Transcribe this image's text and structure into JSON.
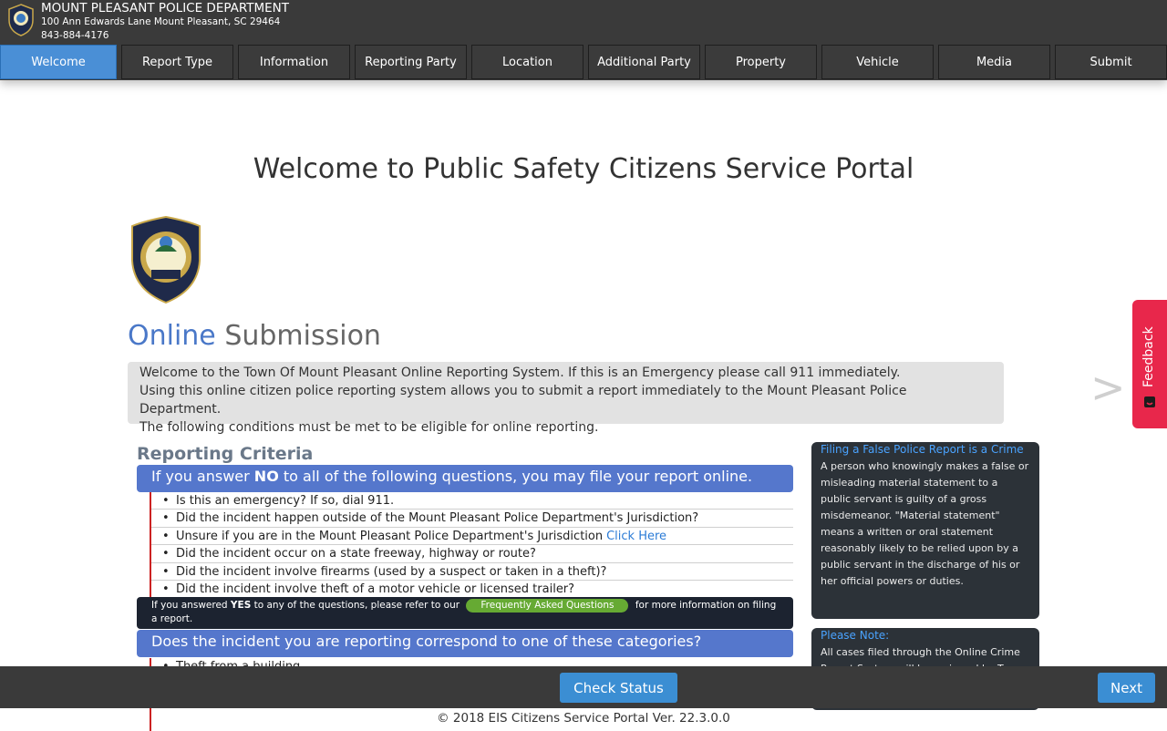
{
  "header": {
    "dept_name": "MOUNT PLEASANT POLICE DEPARTMENT",
    "address": "100 Ann Edwards Lane Mount Pleasant, SC 29464",
    "phone": "843-884-4176"
  },
  "tabs": [
    {
      "label": "Welcome",
      "active": true
    },
    {
      "label": "Report Type"
    },
    {
      "label": "Information"
    },
    {
      "label": "Reporting Party"
    },
    {
      "label": "Location"
    },
    {
      "label": "Additional Party"
    },
    {
      "label": "Property"
    },
    {
      "label": "Vehicle"
    },
    {
      "label": "Media"
    },
    {
      "label": "Submit"
    }
  ],
  "main": {
    "welcome_title": "Welcome to Public Safety Citizens Service Portal",
    "online_word": "Online",
    "submission_word": "Submission",
    "intro_lines": [
      "Welcome to the Town Of Mount Pleasant Online Reporting System. If this is an Emergency please call 911 immediately.",
      "Using this online citizen police reporting system allows you to submit a report immediately to the Mount Pleasant Police Department.",
      "The following conditions must be met to be eligible for online reporting."
    ],
    "criteria_heading": "Reporting Criteria",
    "answer_bar": {
      "pre": "If you answer ",
      "bold": "NO",
      "post": " to all of the following questions, you may file your report online."
    },
    "questions": [
      "Is this an emergency? If so, dial 911.",
      "Did the incident happen outside of the Mount Pleasant Police Department's Jurisdiction?",
      "Unsure if you are in the Mount Pleasant Police Department's Jurisdiction",
      "Did the incident occur on a state freeway, highway or route?",
      "Did the incident involve firearms (used by a suspect or taken in a theft)?",
      "Did the incident involve theft of a motor vehicle or licensed trailer?"
    ],
    "click_here": "Click Here",
    "yes_note": {
      "pre": "If you answered ",
      "bold": "YES",
      "mid": " to any of the questions, please refer to our ",
      "faq": "Frequently Asked Questions",
      "post": " for more information on filing a report."
    },
    "category_bar": "Does the incident you are reporting correspond to one of these categories?",
    "categories": [
      "Theft from a building"
    ]
  },
  "sidebar": {
    "false_report_title": "Filing a False Police Report is a Crime",
    "false_report_text": "A person who knowingly makes a false or misleading material statement to a public servant is guilty of a gross misdemeanor. \"Material statement\" means a written or oral statement reasonably likely to be relied upon by a public servant in the discharge of his or her official powers or duties.",
    "note_title": "Please Note:",
    "note_text": "All cases filed through the Online Crime Report System will be reviewed by To"
  },
  "feedback_label": "Feedback",
  "arrow_glyph": ">",
  "bottom": {
    "check_status": "Check Status",
    "next": "Next",
    "footer": "© 2018 EIS Citizens Service Portal Ver. 22.3.0.0"
  },
  "colors": {
    "accent": "#4a8fd6",
    "header_bg": "#3a3a3a",
    "blue_bar": "#5577cc",
    "feedback": "#e8274b",
    "faq_green": "#66aa33"
  }
}
